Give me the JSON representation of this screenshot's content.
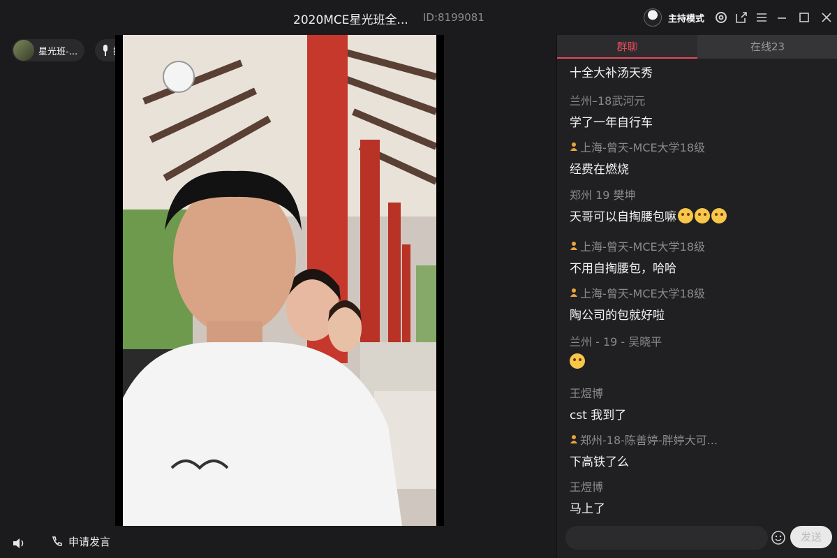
{
  "window": {
    "title": "2020MCE星光班全...",
    "room_id": "ID:8199081",
    "host_mode_label": "主持模式",
    "icons": [
      "settings-icon",
      "popout-icon",
      "menu-icon",
      "minimize-icon",
      "maximize-icon",
      "close-icon"
    ]
  },
  "stage": {
    "user_name": "星光班-...",
    "queue_label": "排麦",
    "apply_label": "申请发言"
  },
  "chat": {
    "tabs": [
      {
        "label": "群聊",
        "active": true
      },
      {
        "label": "在线23",
        "active": false
      }
    ],
    "messages": [
      {
        "sender": "",
        "text": "十全大补汤天秀",
        "badge": false,
        "emoji_count": 0
      },
      {
        "sender": "兰州–18武河元",
        "text": "学了一年自行车",
        "badge": false,
        "emoji_count": 0
      },
      {
        "sender": "上海-曾天-MCE大学18级",
        "text": "经费在燃烧",
        "badge": true,
        "emoji_count": 0
      },
      {
        "sender": "郑州 19 樊坤",
        "text": "天哥可以自掏腰包嘛",
        "badge": false,
        "emoji_count": 3
      },
      {
        "sender": "上海-曾天-MCE大学18级",
        "text": "不用自掏腰包，哈哈",
        "badge": true,
        "emoji_count": 0
      },
      {
        "sender": "上海-曾天-MCE大学18级",
        "text": "陶公司的包就好啦",
        "badge": true,
        "emoji_count": 0
      },
      {
        "sender": "兰州 - 19 - 吴晓平",
        "text": "",
        "badge": false,
        "emoji_count": 1
      },
      {
        "sender": "王煜博",
        "text": "cst 我到了",
        "badge": false,
        "emoji_count": 0
      },
      {
        "sender": "郑州-18-陈善婷-胖婷大可...",
        "text": "下高铁了么",
        "badge": true,
        "emoji_count": 0
      },
      {
        "sender": "王煜博",
        "text": "马上了",
        "badge": false,
        "emoji_count": 0
      }
    ],
    "send_label": "发送",
    "input_placeholder": ""
  },
  "colors": {
    "accent": "#e5495c",
    "background": "#1b1b1d",
    "panel": "#202022"
  }
}
